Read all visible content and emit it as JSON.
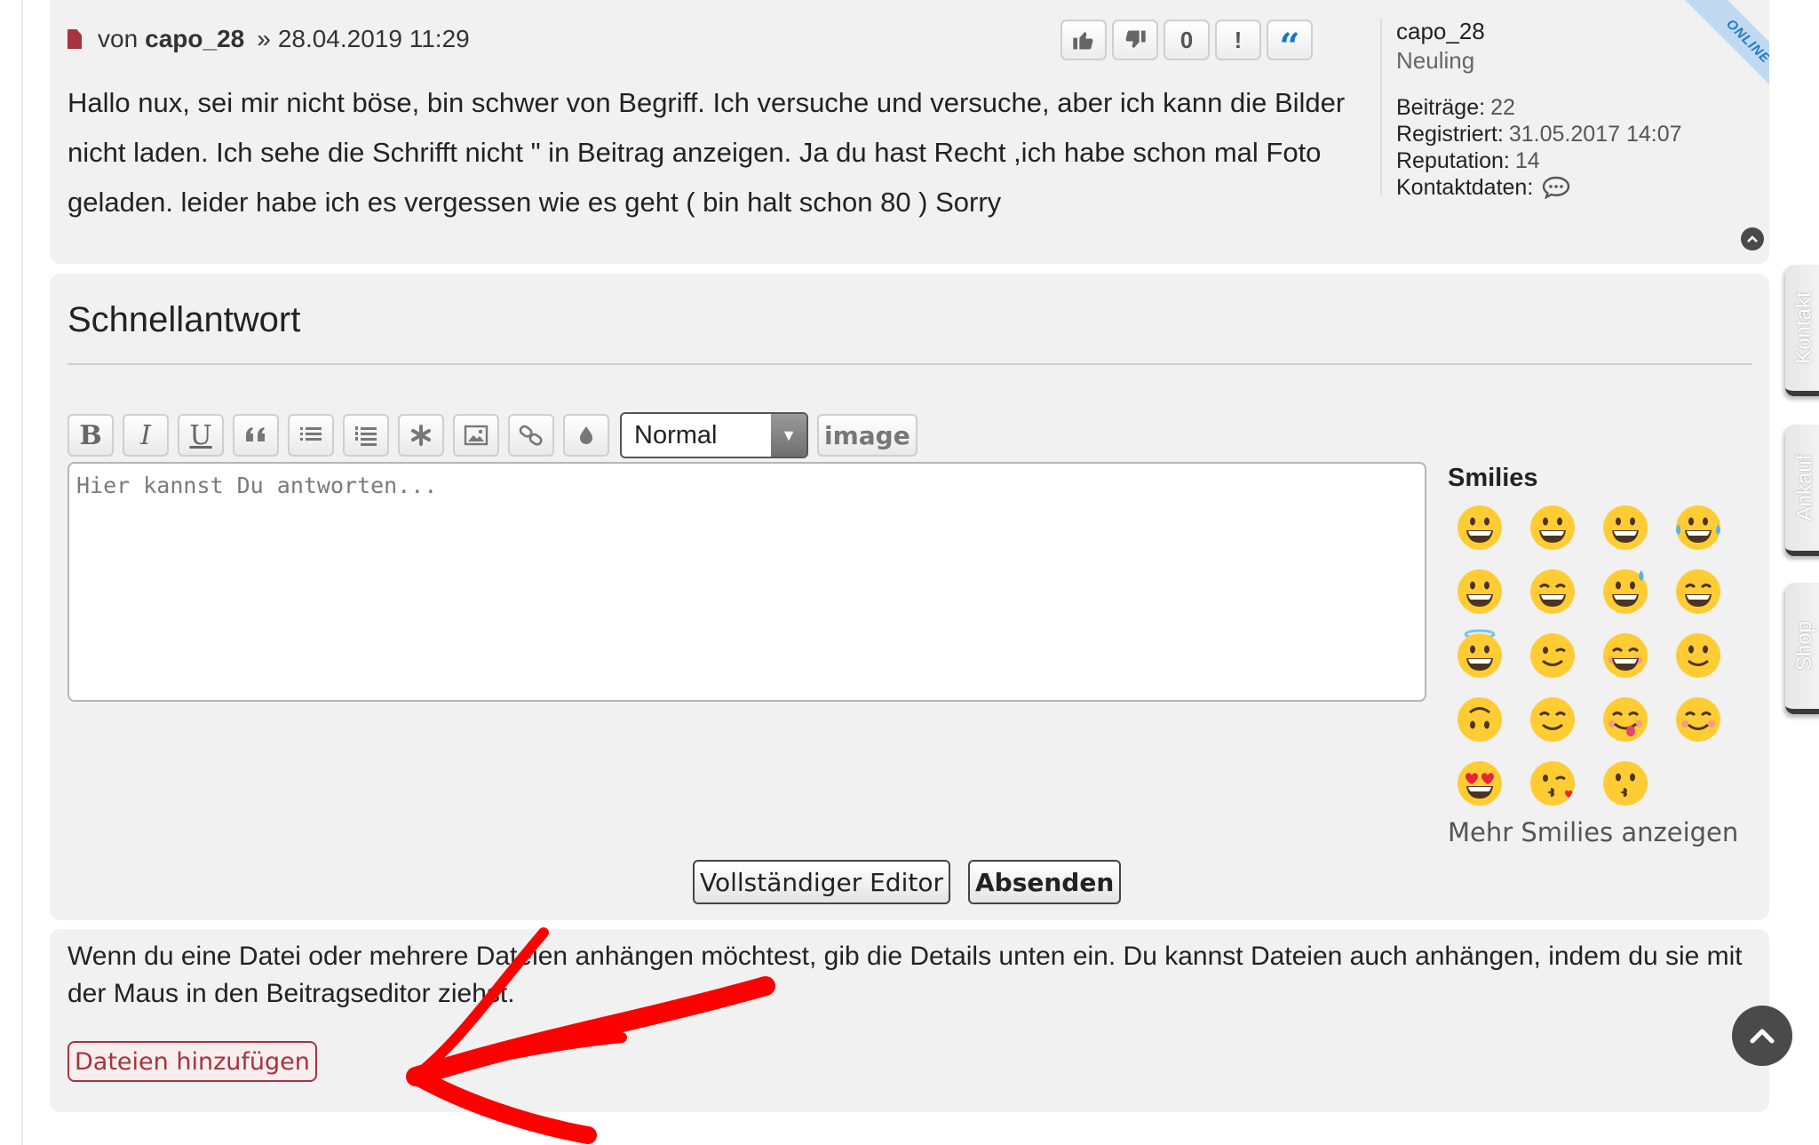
{
  "post": {
    "author_prefix": "von",
    "author": "capo_28",
    "separator": "»",
    "datetime": "28.04.2019 11:29",
    "actions": [
      {
        "name": "thumbs-up-icon",
        "label": ""
      },
      {
        "name": "thumbs-down-icon",
        "label": ""
      },
      {
        "name": "zero-reaction",
        "label": "0"
      },
      {
        "name": "report-icon",
        "label": "!"
      },
      {
        "name": "quote-icon",
        "label": "“"
      }
    ],
    "body": "Hallo nux, sei mir nicht böse, bin schwer von Begriff. Ich versuche und versuche, aber ich kann die Bilder nicht laden. Ich sehe die Schrifft nicht \" in Beitrag anzeigen. Ja du hast Recht ,ich habe schon mal Foto geladen. leider habe ich es vergessen wie es geht ( bin halt schon 80 ) Sorry"
  },
  "profile": {
    "name": "capo_28",
    "rank": "Neuling",
    "posts_label": "Beiträge:",
    "posts_value": "22",
    "registered_label": "Registriert:",
    "registered_value": "31.05.2017 14:07",
    "reputation_label": "Reputation:",
    "reputation_value": "14",
    "contact_label": "Kontaktdaten:",
    "status": "ONLINE"
  },
  "reply": {
    "title": "Schnellantwort",
    "toolbar": {
      "bold": "B",
      "italic": "I",
      "underline": "U",
      "font_size": "Normal",
      "image": "image"
    },
    "placeholder": "Hier kannst Du antworten...",
    "smilies_title": "Smilies",
    "more_smilies": "Mehr Smilies anzeigen",
    "full_editor": "Vollständiger Editor",
    "submit": "Absenden"
  },
  "attachments": {
    "text": "Wenn du eine Datei oder mehrere Dateien anhängen möchtest, gib die Details unten ein. Du kannst Dateien auch anhängen, indem du sie mit der Maus in den Beitragseditor ziehst.",
    "button": "Dateien hinzufügen"
  },
  "side_tabs": {
    "kontakt": "Kontakt",
    "ankauf": "Ankauf",
    "shop": "Shop"
  },
  "colors": {
    "panel": "#f1f1f1",
    "accent_red": "#a8323e",
    "quote_blue": "#1976c9",
    "annotation_red": "#ff0000"
  }
}
